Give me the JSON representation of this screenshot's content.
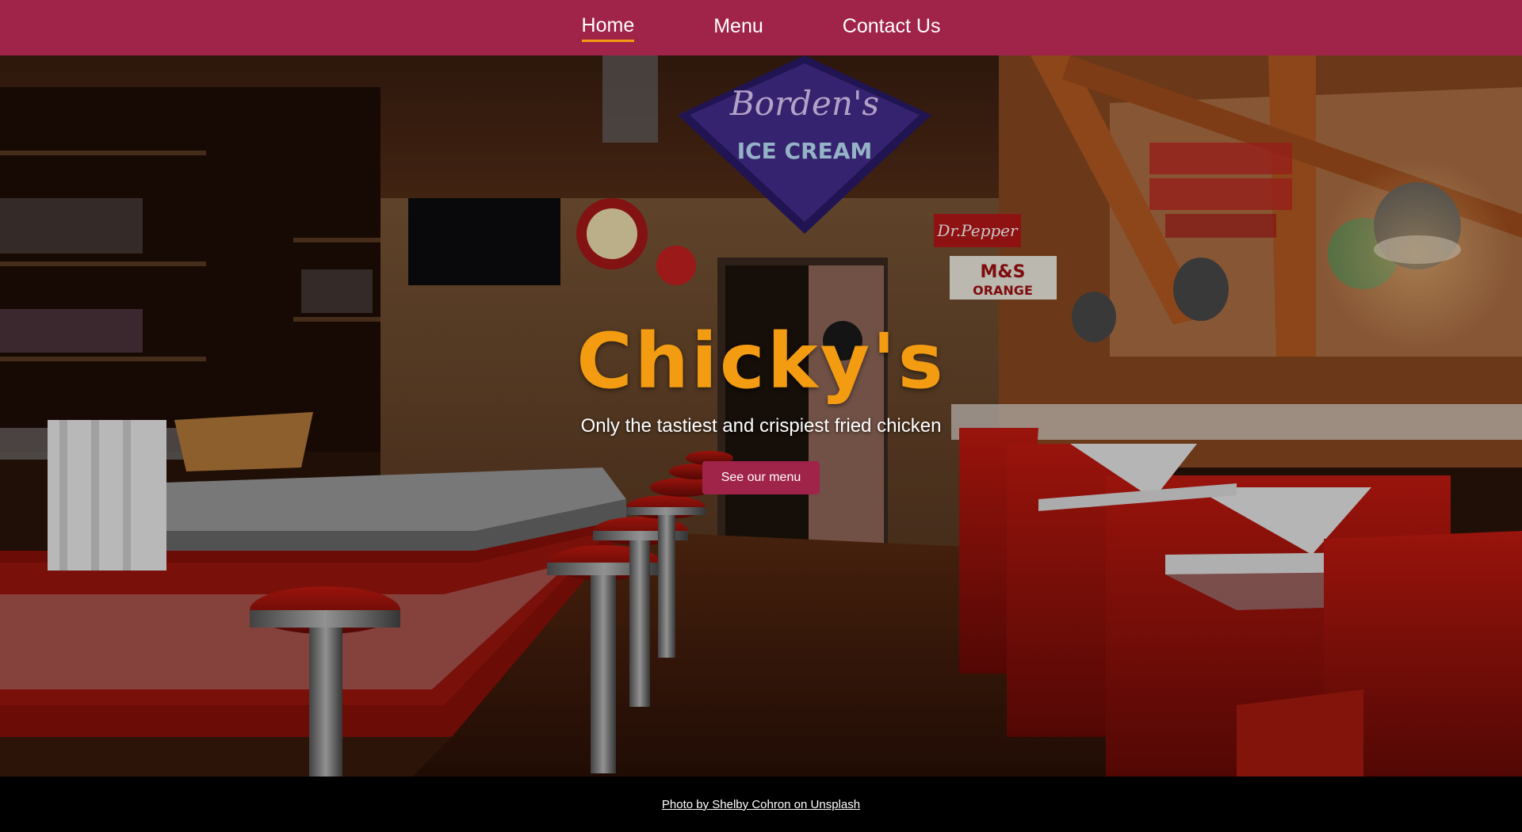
{
  "nav": {
    "items": [
      {
        "label": "Home",
        "active": true
      },
      {
        "label": "Menu",
        "active": false
      },
      {
        "label": "Contact Us",
        "active": false
      }
    ]
  },
  "hero": {
    "title": "Chicky's",
    "subtitle": "Only the tastiest and crispiest fried chicken",
    "button_label": "See our menu",
    "background_description": "retro diner interior with red booths, counter stools and neon signs"
  },
  "footer": {
    "credit_text": "Photo by Shelby Cohron on Unsplash"
  },
  "colors": {
    "brand": "#a0234a",
    "accent": "#f39c12",
    "footer_bg": "#000000"
  }
}
